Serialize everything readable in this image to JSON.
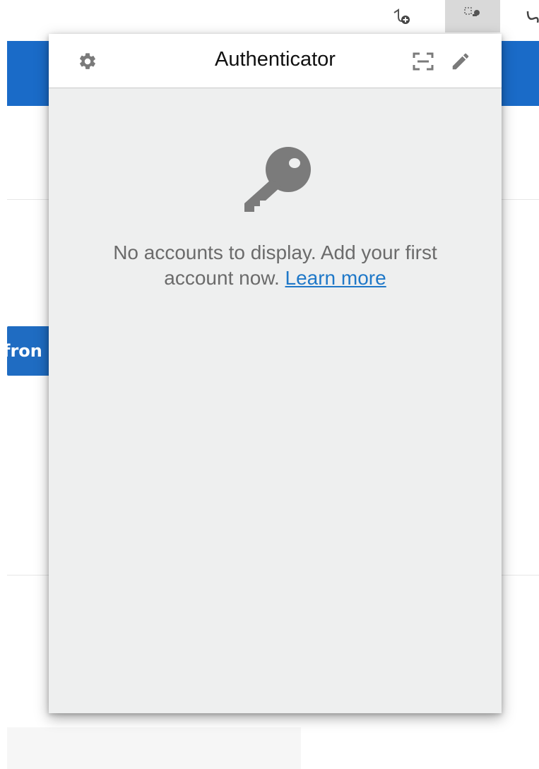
{
  "popup": {
    "title": "Authenticator",
    "empty_message": "No accounts to display. Add your first account now.",
    "learn_more_label": "Learn more",
    "icons": {
      "settings": "gear-icon",
      "scan": "scan-qr-icon",
      "edit": "pencil-icon",
      "empty": "key-icon"
    }
  },
  "background_page": {
    "button_fragment": "fron",
    "accent_color": "#1a6bc8"
  },
  "browser_toolbar": {
    "extension_icons": [
      "add-extension-icon",
      "authenticator-extension-icon",
      "extension-icon"
    ]
  }
}
